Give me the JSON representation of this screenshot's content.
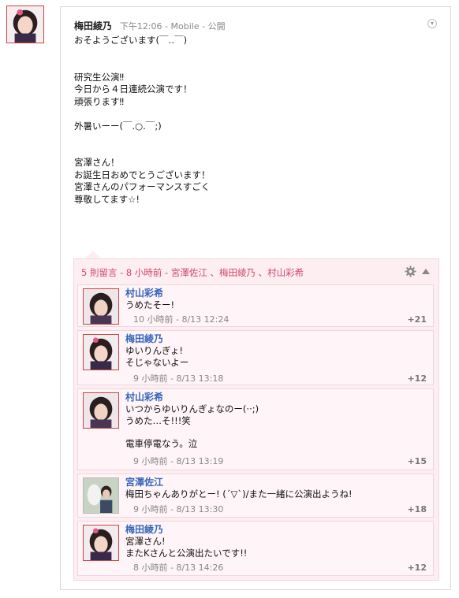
{
  "post": {
    "author": "梅田綾乃",
    "time": "下午12:06",
    "sep1": " - ",
    "source": "Mobile",
    "sep2": " - ",
    "visibility": "公開",
    "body": "おそようございます(￣‥￣)\n\n\n研究生公演‼\n今日から４日連続公演です！\n頑張ります‼\n\n外暑いーー(￣.○.￣;)\n\n\n宮澤さん！\nお誕生日おめでとうございます！\n宮澤さんのパフォーマンスすごく\n尊敬してます☆!"
  },
  "comments": {
    "summary": "5 則留言 - 8 小時前 - 宮澤佐江 、梅田綾乃 、村山彩希",
    "items": [
      {
        "name": "村山彩希",
        "text": "うめたそー!",
        "time": "10 小時前 - 8/13 12:24",
        "plus": "+21"
      },
      {
        "name": "梅田綾乃",
        "text": "ゆいりんぎょ!\nそじゃないよー",
        "time": "9 小時前 - 8/13 13:18",
        "plus": "+12"
      },
      {
        "name": "村山彩希",
        "text": "いつからゆいりんぎょなのー(··;)\nうめた…そ!!!笑\n\n電車停電なう。泣",
        "time": "9 小時前 - 8/13 13:19",
        "plus": "+15"
      },
      {
        "name": "宮澤佐江",
        "text": "梅田ちゃんありがとー! (´▽`)/また一緒に公演出ようね!",
        "time": "9 小時前 - 8/13 13:30",
        "plus": "+18"
      },
      {
        "name": "梅田綾乃",
        "text": "宮澤さん!\nまたKさんと公演出たいです!!",
        "time": "8 小時前 - 8/13 14:26",
        "plus": "+12"
      }
    ]
  },
  "icons": {
    "menu": "chevron-down-circle-icon",
    "settings": "gear-icon",
    "collapse": "triangle-up-icon"
  },
  "colors": {
    "accent": "#d2466f",
    "name_link": "#3366bb",
    "comments_bg": "#fdeef2"
  }
}
